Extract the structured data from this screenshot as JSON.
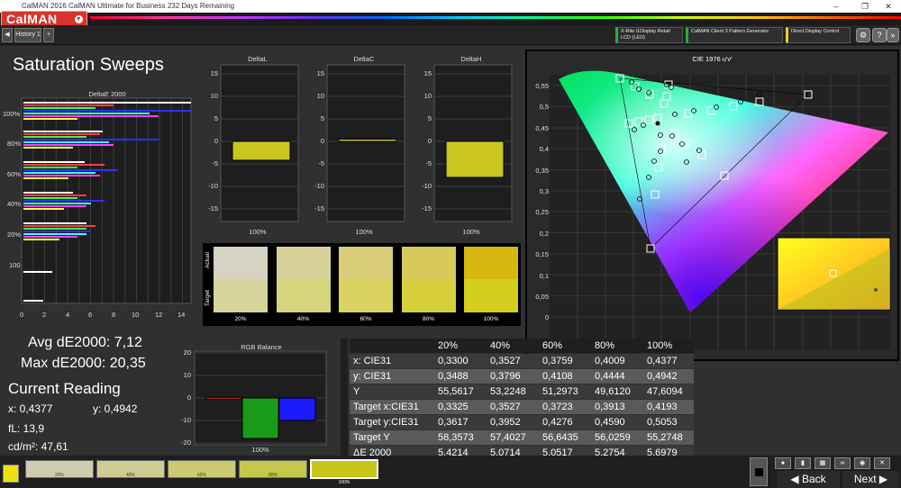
{
  "window": {
    "title": "CalMAN 2016 CalMAN Ultimate for Business 232 Days Remaining",
    "minimize": "–",
    "restore": "❐",
    "close": "✕",
    "brand": "CalMAN"
  },
  "toolbar": {
    "history_tab": "History 1",
    "devices": [
      {
        "line1": "X-Rite i1Display Retail",
        "line2": "LCD (LED)",
        "accent": "#1fb33a"
      },
      {
        "line1": "CalMAN Client 3 Pattern Generator",
        "line2": "",
        "accent": "#1fb33a"
      },
      {
        "line1": "Direct Display Control",
        "line2": "",
        "accent": "#e8d21f"
      }
    ]
  },
  "page": {
    "title": "Saturation Sweeps"
  },
  "deltae_chart": {
    "title": "DeltaE 2000",
    "y_labels": [
      "100%",
      "80%",
      "60%",
      "40%",
      "20%",
      "100"
    ],
    "x_ticks": [
      "0",
      "2",
      "4",
      "6",
      "8",
      "10",
      "12",
      "14"
    ]
  },
  "delta_charts": [
    {
      "title": "DeltaL",
      "value": -4.2,
      "label": "100%"
    },
    {
      "title": "DeltaC",
      "value": 0.5,
      "label": "100%"
    },
    {
      "title": "DeltaH",
      "value": -8.0,
      "label": "100%"
    }
  ],
  "delta_y_ticks": [
    "15",
    "10",
    "5",
    "0",
    "-5",
    "-10",
    "-15"
  ],
  "swatch_panel": {
    "row_labels": [
      "Actual",
      "Target"
    ],
    "columns": [
      {
        "label": "20%",
        "actual": "#d6d3c2",
        "target": "#d7d49b"
      },
      {
        "label": "40%",
        "actual": "#d9d19b",
        "target": "#d7d47e"
      },
      {
        "label": "60%",
        "actual": "#d9cd7a",
        "target": "#d8d35e"
      },
      {
        "label": "80%",
        "actual": "#d7c95a",
        "target": "#d6d03c"
      },
      {
        "label": "100%",
        "actual": "#d5b90e",
        "target": "#d3cf1c"
      }
    ]
  },
  "cie": {
    "title": "CIE 1976 u'v'",
    "y_ticks": [
      "0,55",
      "0,5",
      "0,45",
      "0,4",
      "0,35",
      "0,3",
      "0,25",
      "0,2",
      "0,15",
      "0,1",
      "0,05",
      "0"
    ],
    "x_ticks": [
      "0",
      "0,05",
      "0,1",
      "0,15",
      "0,2",
      "0,25",
      "0,3",
      "0,35",
      "0,4",
      "0,45",
      "0,5",
      "0,55"
    ]
  },
  "summary": {
    "avg": "Avg dE2000: 7,12",
    "max": "Max dE2000: 20,35",
    "current_reading": "Current Reading",
    "x": "x: 0,4377",
    "y": "y: 0,4942",
    "fl": "fL: 13,9",
    "cdm2": "cd/m²: 47,61"
  },
  "rgb_balance": {
    "title": "RGB Balance",
    "y_ticks": [
      "20",
      "10",
      "0",
      "-10",
      "-20"
    ],
    "label": "100%",
    "values": {
      "red": 0.3,
      "green": -18,
      "blue": -10
    }
  },
  "chart_data": [
    {
      "type": "bar",
      "title": "DeltaL",
      "categories": [
        "100%"
      ],
      "values": [
        -4.2
      ],
      "ylim": [
        -15,
        15
      ]
    },
    {
      "type": "bar",
      "title": "DeltaC",
      "categories": [
        "100%"
      ],
      "values": [
        0.5
      ],
      "ylim": [
        -15,
        15
      ]
    },
    {
      "type": "bar",
      "title": "DeltaH",
      "categories": [
        "100%"
      ],
      "values": [
        -8.0
      ],
      "ylim": [
        -15,
        15
      ]
    },
    {
      "type": "bar",
      "title": "RGB Balance",
      "categories": [
        "100%"
      ],
      "series": [
        {
          "values": [
            0.3
          ],
          "color": "#e53030"
        },
        {
          "values": [
            -18
          ],
          "color": "#1a9a1a"
        },
        {
          "values": [
            -10
          ],
          "color": "#1a1aff"
        }
      ],
      "ylim": [
        -20,
        20
      ]
    }
  ],
  "table": {
    "headers": [
      "",
      "20%",
      "40%",
      "60%",
      "80%",
      "100%"
    ],
    "rows": [
      [
        "x: CIE31",
        "0,3300",
        "0,3527",
        "0,3759",
        "0,4009",
        "0,4377"
      ],
      [
        "y: CIE31",
        "0,3488",
        "0,3796",
        "0,4108",
        "0,4444",
        "0,4942"
      ],
      [
        "Y",
        "55,5617",
        "53,2248",
        "51,2973",
        "49,6120",
        "47,6094"
      ],
      [
        "Target x:CIE31",
        "0,3325",
        "0,3527",
        "0,3723",
        "0,3913",
        "0,4193"
      ],
      [
        "Target y:CIE31",
        "0,3617",
        "0,3952",
        "0,4276",
        "0,4590",
        "0,5053"
      ],
      [
        "Target Y",
        "58,3573",
        "57,4027",
        "56,6435",
        "56,0259",
        "55,2748"
      ],
      [
        "ΔE 2000",
        "5,4214",
        "5,0714",
        "5,0517",
        "5,2754",
        "5,6979"
      ]
    ]
  },
  "bottom": {
    "current_color": "#f0e010",
    "swatches": [
      {
        "label": "20%",
        "color": "#cfccb0"
      },
      {
        "label": "40%",
        "color": "#cfcc93"
      },
      {
        "label": "60%",
        "color": "#cccb71"
      },
      {
        "label": "80%",
        "color": "#c6c64d"
      },
      {
        "label": "100%",
        "color": "#c7c51a"
      }
    ],
    "back": "Back",
    "next": "Next"
  }
}
